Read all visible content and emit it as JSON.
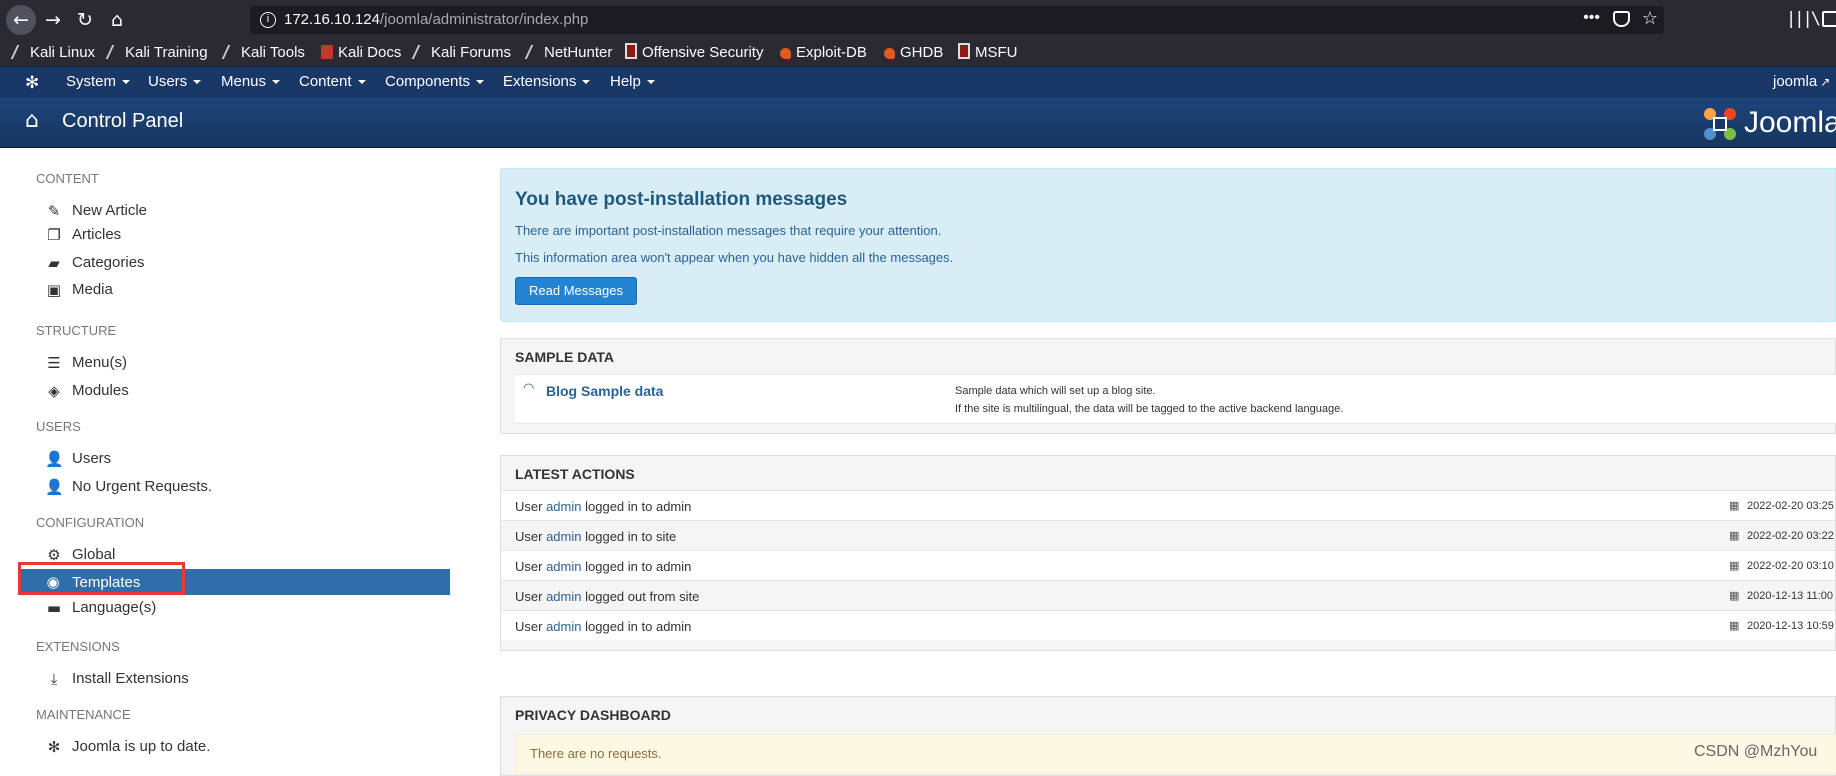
{
  "browser": {
    "url_host": "172.16.10.124",
    "url_path": "/joomla/administrator/index.php",
    "bookmarks": [
      "Kali Linux",
      "Kali Training",
      "Kali Tools",
      "Kali Docs",
      "Kali Forums",
      "NetHunter",
      "Offensive Security",
      "Exploit-DB",
      "GHDB",
      "MSFU"
    ]
  },
  "menubar": {
    "items": [
      "System",
      "Users",
      "Menus",
      "Content",
      "Components",
      "Extensions",
      "Help"
    ],
    "user": "joomla"
  },
  "header": {
    "title": "Control Panel",
    "brand": "Joomla"
  },
  "sidebar": {
    "sections": [
      {
        "heading": "CONTENT",
        "items": [
          "New Article",
          "Articles",
          "Categories",
          "Media"
        ]
      },
      {
        "heading": "STRUCTURE",
        "items": [
          "Menu(s)",
          "Modules"
        ]
      },
      {
        "heading": "USERS",
        "items": [
          "Users",
          "No Urgent Requests."
        ]
      },
      {
        "heading": "CONFIGURATION",
        "items": [
          "Global",
          "Templates",
          "Language(s)"
        ]
      },
      {
        "heading": "EXTENSIONS",
        "items": [
          "Install Extensions"
        ]
      },
      {
        "heading": "MAINTENANCE",
        "items": [
          "Joomla is up to date."
        ]
      }
    ],
    "active_item": "Templates"
  },
  "postinstall": {
    "title": "You have post-installation messages",
    "line1": "There are important post-installation messages that require your attention.",
    "line2": "This information area won't appear when you have hidden all the messages.",
    "button": "Read Messages"
  },
  "sample_data": {
    "heading": "SAMPLE DATA",
    "link": "Blog Sample data",
    "desc1": "Sample data which will set up a blog site.",
    "desc2": "If the site is multilingual, the data will be tagged to the active backend language."
  },
  "latest_actions": {
    "heading": "LATEST ACTIONS",
    "rows": [
      {
        "prefix": "User",
        "user": "admin",
        "action": "logged in to admin",
        "date": "2022-02-20 03:25"
      },
      {
        "prefix": "User",
        "user": "admin",
        "action": "logged in to site",
        "date": "2022-02-20 03:22"
      },
      {
        "prefix": "User",
        "user": "admin",
        "action": "logged in to admin",
        "date": "2022-02-20 03:10"
      },
      {
        "prefix": "User",
        "user": "admin",
        "action": "logged out from site",
        "date": "2020-12-13 11:00"
      },
      {
        "prefix": "User",
        "user": "admin",
        "action": "logged in to admin",
        "date": "2020-12-13 10:59"
      }
    ]
  },
  "privacy": {
    "heading": "PRIVACY DASHBOARD",
    "message": "There are no requests."
  },
  "watermark": "CSDN @MzhYou"
}
